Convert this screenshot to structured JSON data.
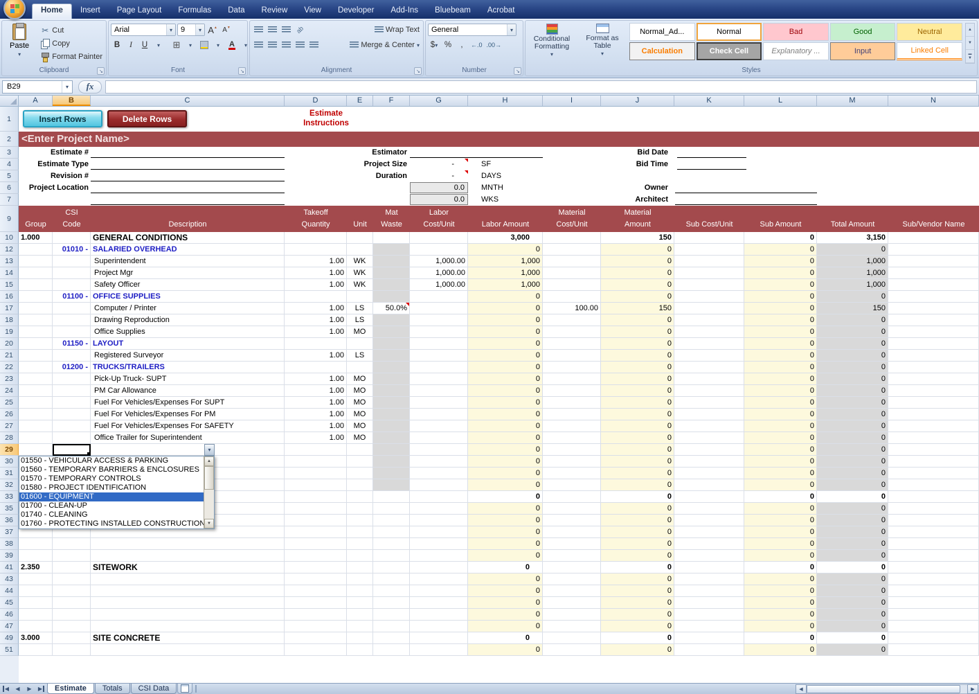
{
  "ribbon": {
    "tabs": [
      {
        "label": "Home",
        "active": true
      },
      {
        "label": "Insert"
      },
      {
        "label": "Page Layout"
      },
      {
        "label": "Formulas"
      },
      {
        "label": "Data"
      },
      {
        "label": "Review"
      },
      {
        "label": "View"
      },
      {
        "label": "Developer"
      },
      {
        "label": "Add-Ins"
      },
      {
        "label": "Bluebeam"
      },
      {
        "label": "Acrobat"
      }
    ],
    "clipboard": {
      "label": "Clipboard",
      "paste": "Paste",
      "cut": "Cut",
      "copy": "Copy",
      "format_painter": "Format Painter"
    },
    "font": {
      "label": "Font",
      "name": "Arial",
      "size": "9",
      "bold": "B",
      "italic": "I",
      "underline": "U"
    },
    "alignment": {
      "label": "Alignment",
      "wrap_text": "Wrap Text",
      "merge_center": "Merge & Center"
    },
    "number": {
      "label": "Number",
      "format": "General",
      "currency": "$",
      "percent": "%",
      "comma": ","
    },
    "styles": {
      "label": "Styles",
      "conditional": "Conditional Formatting",
      "format_table": "Format as Table",
      "cells": [
        {
          "key": "normal-alt",
          "label": "Normal_Ad..."
        },
        {
          "key": "normal",
          "label": "Normal",
          "selected": true
        },
        {
          "key": "bad",
          "label": "Bad"
        },
        {
          "key": "good",
          "label": "Good"
        },
        {
          "key": "neutral",
          "label": "Neutral"
        },
        {
          "key": "calculation",
          "label": "Calculation"
        },
        {
          "key": "check-cell",
          "label": "Check Cell"
        },
        {
          "key": "explanatory",
          "label": "Explanatory ..."
        },
        {
          "key": "input",
          "label": "Input"
        },
        {
          "key": "linked-cell",
          "label": "Linked Cell"
        }
      ]
    }
  },
  "formula_bar": {
    "name_box": "B29",
    "fx": "fx"
  },
  "colors": {
    "accent_red": "#a34a4d",
    "input_yellow": "#fdf9dd",
    "calc_gray": "#d9d9d9",
    "selection_blue": "#316ac5",
    "instruction_red": "#c00000"
  },
  "icons": {
    "office-button": "office-logo",
    "dropdown-arrow": "▾",
    "scissors": "✂",
    "comment-indicator": "red-triangle",
    "nav-first": "|◀",
    "nav-prev": "◀",
    "nav-next": "▶",
    "nav-last": "▶|",
    "scroll-up": "▲",
    "scroll-down": "▼"
  },
  "sheet": {
    "columns": [
      "A",
      "B",
      "C",
      "D",
      "E",
      "F",
      "G",
      "H",
      "I",
      "J",
      "K",
      "L",
      "M",
      "N"
    ],
    "selection": {
      "cell": "B29",
      "col": "B",
      "row": 29
    },
    "buttons": {
      "insert_rows": "Insert Rows",
      "delete_rows": "Delete Rows"
    },
    "instructions": [
      "Estimate",
      "Instructions"
    ],
    "project_banner": "<Enter Project Name>",
    "form": {
      "estimate_no": "Estimate #",
      "estimate_type": "Estimate Type",
      "revision": "Revision #",
      "project_location": "Project Location",
      "estimator": "Estimator",
      "project_size": "Project Size",
      "duration": "Duration",
      "size_value": "-",
      "size_unit": "SF",
      "duration_value": "-",
      "duration_unit": "DAYS",
      "months_value": "0.0",
      "months_unit": "MNTH",
      "weeks_value": "0.0",
      "weeks_unit": "WKS",
      "bid_date": "Bid Date",
      "bid_time": "Bid Time",
      "owner": "Owner",
      "architect": "Architect"
    },
    "table_header": [
      {
        "c": "A",
        "l1": "",
        "l2": "Group"
      },
      {
        "c": "B",
        "l1": "CSI",
        "l2": "Code"
      },
      {
        "c": "C",
        "l1": "",
        "l2": "Description"
      },
      {
        "c": "D",
        "l1": "Takeoff",
        "l2": "Quantity"
      },
      {
        "c": "E",
        "l1": "",
        "l2": "Unit"
      },
      {
        "c": "F",
        "l1": "Mat",
        "l2": "Waste"
      },
      {
        "c": "G",
        "l1": "Labor",
        "l2": "Cost/Unit"
      },
      {
        "c": "H",
        "l1": "",
        "l2": "Labor Amount"
      },
      {
        "c": "I",
        "l1": "Material",
        "l2": "Cost/Unit"
      },
      {
        "c": "J",
        "l1": "Material",
        "l2": "Amount"
      },
      {
        "c": "K",
        "l1": "",
        "l2": "Sub Cost/Unit"
      },
      {
        "c": "L",
        "l1": "",
        "l2": "Sub Amount"
      },
      {
        "c": "M",
        "l1": "",
        "l2": "Total Amount"
      },
      {
        "c": "N",
        "l1": "",
        "l2": "Sub/Vendor Name"
      }
    ],
    "rows": [
      {
        "n": 1,
        "type": "buttons"
      },
      {
        "n": 2,
        "type": "banner"
      },
      {
        "n": 3,
        "type": "form"
      },
      {
        "n": 4,
        "type": "form"
      },
      {
        "n": 5,
        "type": "form"
      },
      {
        "n": 6,
        "type": "form"
      },
      {
        "n": 7,
        "type": "form"
      },
      {
        "n": 9,
        "type": "header"
      },
      {
        "n": 10,
        "type": "section",
        "a": "1.000",
        "desc": "GENERAL CONDITIONS",
        "h": "3,000",
        "j": "150",
        "l": "0",
        "m": "3,150"
      },
      {
        "n": 12,
        "type": "csi",
        "code": "01010",
        "desc": "SALARIED OVERHEAD",
        "h": "0",
        "j": "0",
        "l": "0",
        "m": "0"
      },
      {
        "n": 13,
        "type": "item",
        "desc": "Superintendent",
        "qty": "1.00",
        "unit": "WK",
        "g": "1,000.00",
        "h": "1,000",
        "j": "0",
        "l": "0",
        "m": "1,000"
      },
      {
        "n": 14,
        "type": "item",
        "desc": "Project Mgr",
        "qty": "1.00",
        "unit": "WK",
        "g": "1,000.00",
        "h": "1,000",
        "j": "0",
        "l": "0",
        "m": "1,000"
      },
      {
        "n": 15,
        "type": "item",
        "desc": "Safety Officer",
        "qty": "1.00",
        "unit": "WK",
        "g": "1,000.00",
        "h": "1,000",
        "j": "0",
        "l": "0",
        "m": "1,000"
      },
      {
        "n": 16,
        "type": "csi",
        "code": "01100",
        "desc": "OFFICE SUPPLIES",
        "h": "0",
        "j": "0",
        "l": "0",
        "m": "0"
      },
      {
        "n": 17,
        "type": "item",
        "desc": "Computer / Printer",
        "qty": "1.00",
        "unit": "LS",
        "waste": "50.0%",
        "comment": true,
        "h": "0",
        "i": "100.00",
        "j": "150",
        "l": "0",
        "m": "150"
      },
      {
        "n": 18,
        "type": "item",
        "desc": "Drawing Reproduction",
        "qty": "1.00",
        "unit": "LS",
        "h": "0",
        "j": "0",
        "l": "0",
        "m": "0"
      },
      {
        "n": 19,
        "type": "item",
        "desc": "Office Supplies",
        "qty": "1.00",
        "unit": "MO",
        "h": "0",
        "j": "0",
        "l": "0",
        "m": "0"
      },
      {
        "n": 20,
        "type": "csi",
        "code": "01150",
        "desc": "LAYOUT",
        "h": "0",
        "j": "0",
        "l": "0",
        "m": "0"
      },
      {
        "n": 21,
        "type": "item",
        "desc": "Registered Surveyor",
        "qty": "1.00",
        "unit": "LS",
        "h": "0",
        "j": "0",
        "l": "0",
        "m": "0"
      },
      {
        "n": 22,
        "type": "csi",
        "code": "01200",
        "desc": "TRUCKS/TRAILERS",
        "h": "0",
        "j": "0",
        "l": "0",
        "m": "0"
      },
      {
        "n": 23,
        "type": "item",
        "desc": "Pick-Up Truck- SUPT",
        "qty": "1.00",
        "unit": "MO",
        "h": "0",
        "j": "0",
        "l": "0",
        "m": "0"
      },
      {
        "n": 24,
        "type": "item",
        "desc": "PM Car Allowance",
        "qty": "1.00",
        "unit": "MO",
        "h": "0",
        "j": "0",
        "l": "0",
        "m": "0"
      },
      {
        "n": 25,
        "type": "item",
        "desc": "Fuel For Vehicles/Expenses For SUPT",
        "qty": "1.00",
        "unit": "MO",
        "h": "0",
        "j": "0",
        "l": "0",
        "m": "0"
      },
      {
        "n": 26,
        "type": "item",
        "desc": "Fuel For Vehicles/Expenses For PM",
        "qty": "1.00",
        "unit": "MO",
        "h": "0",
        "j": "0",
        "l": "0",
        "m": "0"
      },
      {
        "n": 27,
        "type": "item",
        "desc": "Fuel For Vehicles/Expenses For SAFETY",
        "qty": "1.00",
        "unit": "MO",
        "h": "0",
        "j": "0",
        "l": "0",
        "m": "0"
      },
      {
        "n": 28,
        "type": "item",
        "desc": "Office Trailer for Superintendent",
        "qty": "1.00",
        "unit": "MO",
        "h": "0",
        "j": "0",
        "l": "0",
        "m": "0"
      },
      {
        "n": 29,
        "type": "blank",
        "selected": true,
        "dropdown": true,
        "shadeF": true,
        "h": "0",
        "j": "0",
        "l": "0",
        "m": "0"
      },
      {
        "n": 30,
        "type": "blank",
        "shadeF": true,
        "h": "0",
        "j": "0",
        "l": "0",
        "m": "0"
      },
      {
        "n": 31,
        "type": "blank",
        "shadeF": true,
        "h": "0",
        "j": "0",
        "l": "0",
        "m": "0"
      },
      {
        "n": 32,
        "type": "blank",
        "shadeF": true,
        "h": "0",
        "j": "0",
        "l": "0",
        "m": "0"
      },
      {
        "n": 33,
        "type": "total",
        "h": "0",
        "j": "0",
        "l": "0",
        "m": "0"
      },
      {
        "n": 35,
        "type": "blank",
        "h": "0",
        "j": "0",
        "l": "0",
        "m": "0"
      },
      {
        "n": 36,
        "type": "blank",
        "h": "0",
        "j": "0",
        "l": "0",
        "m": "0"
      },
      {
        "n": 37,
        "type": "blank",
        "h": "0",
        "j": "0",
        "l": "0",
        "m": "0"
      },
      {
        "n": 38,
        "type": "blank",
        "h": "0",
        "j": "0",
        "l": "0",
        "m": "0"
      },
      {
        "n": 39,
        "type": "blank",
        "h": "0",
        "j": "0",
        "l": "0",
        "m": "0"
      },
      {
        "n": 41,
        "type": "section",
        "a": "2.350",
        "desc": "SITEWORK",
        "h": "0",
        "j": "0",
        "l": "0",
        "m": "0"
      },
      {
        "n": 43,
        "type": "blank",
        "h": "0",
        "j": "0",
        "l": "0",
        "m": "0"
      },
      {
        "n": 44,
        "type": "blank",
        "h": "0",
        "j": "0",
        "l": "0",
        "m": "0"
      },
      {
        "n": 45,
        "type": "blank",
        "h": "0",
        "j": "0",
        "l": "0",
        "m": "0"
      },
      {
        "n": 46,
        "type": "blank",
        "h": "0",
        "j": "0",
        "l": "0",
        "m": "0"
      },
      {
        "n": 47,
        "type": "blank",
        "h": "0",
        "j": "0",
        "l": "0",
        "m": "0"
      },
      {
        "n": 49,
        "type": "section",
        "a": "3.000",
        "desc": "SITE CONCRETE",
        "h": "0",
        "j": "0",
        "l": "0",
        "m": "0"
      },
      {
        "n": 51,
        "type": "blank",
        "h": "0",
        "j": "0",
        "l": "0",
        "m": "0"
      }
    ],
    "dropdown": {
      "items": [
        "01550  -  VEHICULAR ACCESS & PARKING",
        "01560  -  TEMPORARY BARRIERS & ENCLOSURES",
        "01570  -  TEMPORARY CONTROLS",
        "01580  -  PROJECT IDENTIFICATION",
        "01600  -  EQUIPMENT",
        "01700  -  CLEAN-UP",
        "01740  -  CLEANING",
        "01760  -  PROTECTING INSTALLED CONSTRUCTION"
      ],
      "selected_index": 4
    }
  },
  "sheet_tabs": {
    "tabs": [
      {
        "label": "Estimate",
        "active": true
      },
      {
        "label": "Totals"
      },
      {
        "label": "CSI Data"
      }
    ]
  }
}
